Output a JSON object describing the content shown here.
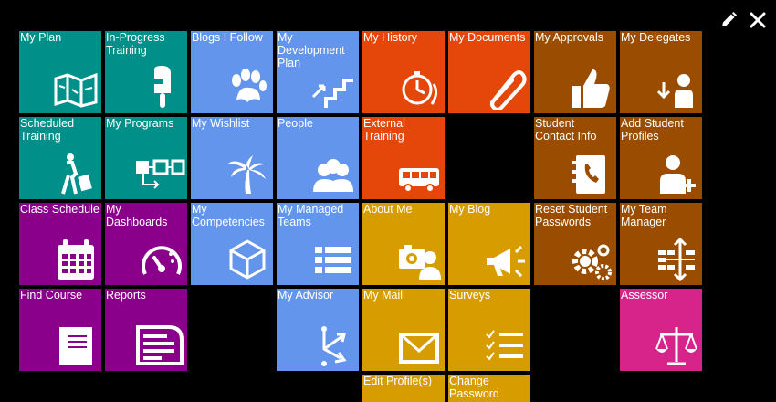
{
  "tiles": {
    "my_plan": "My Plan",
    "in_progress": "In-Progress Training",
    "blogs_follow": "Blogs I Follow",
    "my_development": "My Development Plan",
    "my_history": "My History",
    "my_documents": "My Documents",
    "my_approvals": "My Approvals",
    "my_delegates": "My Delegates",
    "scheduled": "Scheduled Training",
    "my_programs": "My Programs",
    "my_wishlist": "My Wishlist",
    "people": "People",
    "external": "External Training",
    "student_contact": "Student Contact Info",
    "add_student": "Add Student Profiles",
    "class_schedule": "Class Schedule",
    "my_dashboards": "My Dashboards",
    "my_competencies": "My Competencies",
    "managed_teams": "My Managed Teams",
    "about_me": "About Me",
    "my_blog": "My Blog",
    "reset_passwords": "Reset Student Passwords",
    "team_manager": "My Team Manager",
    "find_course": "Find Course",
    "reports": "Reports",
    "my_advisor": "My Advisor",
    "my_mail": "My Mail",
    "surveys": "Surveys",
    "assessor": "Assessor",
    "edit_profile": "Edit Profile(s)",
    "change_password": "Change Password"
  },
  "icons": {
    "edit": "pencil-icon",
    "close": "close-icon"
  },
  "colors": {
    "teal": "#009089",
    "blue": "#6495ed",
    "orange": "#e5470b",
    "brown": "#9a4c00",
    "purple": "#8a008a",
    "gold": "#d79d00",
    "pink": "#d6248b"
  }
}
